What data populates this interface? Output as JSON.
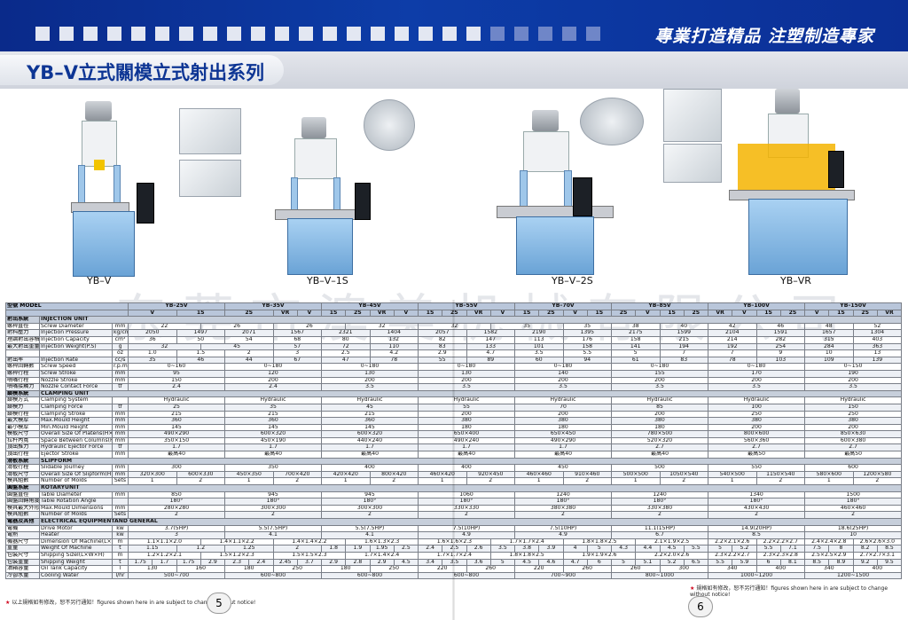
{
  "header": {
    "slogan": "專業打造精品 注塑制造專家",
    "series_title": "YB–V立式關模立式射出系列"
  },
  "colors": {
    "brand_blue": "#0d3da8",
    "section_bg": "#c7cfdb",
    "accent_yellow": "#f4b400"
  },
  "machines": [
    "YB–V",
    "YB–V–1S",
    "YB–V–2S",
    "YB–VR"
  ],
  "watermark": "东莞市澳美机械有限公司",
  "spec": {
    "model_label": "型號 MODEL",
    "models": [
      "YB–25V",
      "YB–35V",
      "YB–45V",
      "YB–55V",
      "YB–70V",
      "YB–85V",
      "YB–100V",
      "YB–150V"
    ],
    "subheads": [
      "V",
      "1S",
      "2S",
      "VR",
      "V",
      "1S",
      "2S",
      "VR",
      "V",
      "1S",
      "2S",
      "VR",
      "V",
      "1S",
      "2S",
      "V",
      "1S",
      "2S",
      "V",
      "1S",
      "2S",
      "VR",
      "V",
      "1S",
      "2S",
      "V",
      "1S",
      "2S",
      "VR"
    ],
    "sections": [
      {
        "zh": "射出系統",
        "en": "INJECTION UNIT",
        "rows": [
          {
            "zh": "螺桿直徑",
            "en": "Screw Diameter",
            "unit": "mm",
            "vals": [
              "22",
              "26",
              "26",
              "32",
              "32",
              "35",
              "35",
              "38",
              "40",
              "42",
              "46",
              "48",
              "52"
            ]
          },
          {
            "zh": "射料壓力",
            "en": "Injection Pressure",
            "unit": "kg/cm²",
            "vals": [
              "2050",
              "1497",
              "2071",
              "1567",
              "2321",
              "1404",
              "2057",
              "1582",
              "2190",
              "1395",
              "2175",
              "1599",
              "2104",
              "1591",
              "1657",
              "1304"
            ]
          },
          {
            "zh": "理論射出容積",
            "en": "Injection Capacity",
            "unit": "cm³",
            "vals": [
              "36",
              "50",
              "54",
              "68",
              "80",
              "132",
              "82",
              "147",
              "113",
              "176",
              "158",
              "215",
              "214",
              "282",
              "315",
              "403"
            ]
          },
          {
            "zh": "最大射出重量",
            "en": "Injection Weight(P.S)",
            "unit": "g",
            "vals": [
              "32",
              "45",
              "57",
              "72",
              "110",
              "83",
              "133",
              "101",
              "158",
              "141",
              "194",
              "192",
              "254",
              "284",
              "363"
            ]
          },
          {
            "zh": "",
            "en": "",
            "unit": "oz",
            "vals": [
              "1.0",
              "1.5",
              "2",
              "3",
              "2.5",
              "4.2",
              "2.9",
              "4.7",
              "3.5",
              "5.5",
              "5",
              "7",
              "7",
              "9",
              "10",
              "13"
            ]
          },
          {
            "zh": "射出率",
            "en": "Injection Rate",
            "unit": "cc/s",
            "vals": [
              "35",
              "46",
              "44",
              "67",
              "47",
              "78",
              "55",
              "89",
              "60",
              "94",
              "61",
              "83",
              "78",
              "103",
              "109",
              "139"
            ]
          },
          {
            "zh": "螺桿回轉數",
            "en": "Screw Speed",
            "unit": "r.p.m",
            "vals": [
              "0~160",
              "0~180",
              "0~180",
              "0~180",
              "0~180",
              "0~180",
              "0~180",
              "0~150"
            ]
          },
          {
            "zh": "螺桿行程",
            "en": "Screw Stroke",
            "unit": "mm",
            "vals": [
              "95",
              "120",
              "130",
              "130",
              "140",
              "155",
              "170",
              "190"
            ]
          },
          {
            "zh": "噴嘴行程",
            "en": "Nozzle Stroke",
            "unit": "mm",
            "vals": [
              "150",
              "200",
              "200",
              "200",
              "200",
              "200",
              "200",
              "200"
            ]
          },
          {
            "zh": "噴嘴接觸力",
            "en": "Nozzle Contact Force",
            "unit": "tf",
            "vals": [
              "2.4",
              "2.4",
              "3.5",
              "3.5",
              "3.5",
              "3.5",
              "3.5",
              "3.5"
            ]
          }
        ]
      },
      {
        "zh": "鎖模系統",
        "en": "CLAMPING UNIT",
        "rows": [
          {
            "zh": "鎖模方式",
            "en": "Clamping System",
            "unit": "",
            "vals": [
              "Hydraulic",
              "Hydraulic",
              "Hydraulic",
              "Hydraulic",
              "Hydraulic",
              "Hydraulic",
              "Hydraulic",
              "Hydraulic"
            ]
          },
          {
            "zh": "鎖模力",
            "en": "Clamping Force",
            "unit": "tf",
            "vals": [
              "25",
              "35",
              "45",
              "55",
              "70",
              "85",
              "100",
              "150"
            ]
          },
          {
            "zh": "鎖模行程",
            "en": "Clamping Stroke",
            "unit": "mm",
            "vals": [
              "215",
              "215",
              "215",
              "200",
              "200",
              "200",
              "250",
              "250"
            ]
          },
          {
            "zh": "最大模厚",
            "en": "Max.Mould Height",
            "unit": "mm",
            "vals": [
              "360",
              "360",
              "360",
              "380",
              "380",
              "380",
              "380",
              "380"
            ]
          },
          {
            "zh": "最小模厚",
            "en": "Min.Mould Height",
            "unit": "mm",
            "vals": [
              "145",
              "145",
              "145",
              "180",
              "180",
              "180",
              "200",
              "200"
            ]
          },
          {
            "zh": "模板尺寸",
            "en": "Overall Size Of Platens(H×V)",
            "unit": "mm",
            "vals": [
              "490×290",
              "600×320",
              "600×320",
              "650×400",
              "650×450",
              "780×500",
              "800×600",
              "850×630"
            ]
          },
          {
            "zh": "拉杆內寬",
            "en": "Space Between Columns(H×V)",
            "unit": "mm",
            "vals": [
              "350×150",
              "450×190",
              "440×240",
              "490×240",
              "490×290",
              "520×320",
              "560×360",
              "600×380"
            ]
          },
          {
            "zh": "頂出推力",
            "en": "Hydraulic Ejector Force",
            "unit": "tf",
            "vals": [
              "1.7",
              "1.7",
              "1.7",
              "1.7",
              "1.7",
              "2.7",
              "2.7",
              "2.7"
            ]
          },
          {
            "zh": "頂出行程",
            "en": "Ejector Stroke",
            "unit": "mm",
            "vals": [
              "最高40",
              "最高40",
              "最高40",
              "最高40",
              "最高40",
              "最高40",
              "最高50",
              "最高50"
            ]
          }
        ]
      },
      {
        "zh": "滑板系統",
        "en": "SLIPFORM",
        "rows": [
          {
            "zh": "滑板行程",
            "en": "Slidable Journey",
            "unit": "mm",
            "vals": [
              "300",
              "350",
              "400",
              "400",
              "450",
              "500",
              "550",
              "600"
            ]
          },
          {
            "zh": "滑板尺寸",
            "en": "Overall Size Of Slipform(H×V)",
            "unit": "mm",
            "vals": [
              "320×300",
              "600×330",
              "450×350",
              "700×420",
              "420×420",
              "800×420",
              "460×420",
              "920×450",
              "460×460",
              "910×460",
              "500×500",
              "1050×540",
              "540×500",
              "1150×540",
              "580×600",
              "1200×580"
            ]
          },
          {
            "zh": "模具組數",
            "en": "Number of Molds",
            "unit": "Sets",
            "vals": [
              "1",
              "2",
              "1",
              "2",
              "1",
              "2",
              "1",
              "2",
              "1",
              "2",
              "1",
              "2",
              "1",
              "2",
              "1",
              "2"
            ]
          }
        ]
      },
      {
        "zh": "圓盤系統",
        "en": "ROTARYUNIT",
        "rows": [
          {
            "zh": "圓盤直徑",
            "en": "Table Diameter",
            "unit": "mm",
            "vals": [
              "850",
              "945",
              "945",
              "1060",
              "1240",
              "1240",
              "1340",
              "1500"
            ]
          },
          {
            "zh": "圓盤回轉角度(左或右轉)",
            "en": "Table Rotation Angle",
            "unit": "",
            "vals": [
              "180°",
              "180°",
              "180°",
              "180°",
              "180°",
              "180°",
              "180°",
              "180°"
            ]
          },
          {
            "zh": "模具最大外形尺寸",
            "en": "Max.Mould Dimensions",
            "unit": "mm",
            "vals": [
              "280×280",
              "300×300",
              "300×300",
              "330×330",
              "380×380",
              "330×380",
              "430×430",
              "460×460"
            ]
          },
          {
            "zh": "模具組數",
            "en": "Number of Molds",
            "unit": "Sets",
            "vals": [
              "2",
              "2",
              "2",
              "2",
              "2",
              "2",
              "2",
              "2"
            ]
          }
        ]
      },
      {
        "zh": "電器及其他",
        "en": "ELECTRICAL EQUIPMENTAND GENERAL",
        "rows": [
          {
            "zh": "電機",
            "en": "Drive Motor",
            "unit": "kw",
            "vals": [
              "3.7(5HP)",
              "5.5(7.5HP)",
              "5.5(7.5HP)",
              "7.5(10HP)",
              "7.5(10HP)",
              "11.1(15HP)",
              "14.9(20HP)",
              "18.6(25HP)"
            ]
          },
          {
            "zh": "電熱",
            "en": "Heater",
            "unit": "kw",
            "vals": [
              "3",
              "4.1",
              "4.1",
              "4.9",
              "4.9",
              "6.7",
              "8.5",
              "10"
            ]
          },
          {
            "zh": "機器尺寸",
            "en": "Dimension Of Machine(L×W×H)",
            "unit": "m",
            "vals": [
              "1.1×1.1×2.0",
              "1.4×1.1×2.2",
              "1.4×1.4×2.2",
              "1.6×1.3×2.3",
              "1.6×1.6×2.3",
              "1.7×1.7×2.4",
              "1.8×1.8×2.5",
              "2.1×1.9×2.5",
              "2.2×2.1×2.6",
              "2.2×2.2×2.7",
              "2.4×2.4×2.8",
              "2.6×2.6×3.0"
            ]
          },
          {
            "zh": "重量",
            "en": "Weight Of Machine",
            "unit": "t",
            "vals": [
              "1.15",
              "1.2",
              "1.25",
              "2",
              "1.8",
              "1.9",
              "1.95",
              "2.5",
              "2.4",
              "2.5",
              "2.6",
              "3.5",
              "3.8",
              "3.9",
              "4",
              "5",
              "4.3",
              "4.4",
              "4.5",
              "5.5",
              "5",
              "5.2",
              "5.5",
              "7.1",
              "7.5",
              "8",
              "8.2",
              "8.5"
            ]
          },
          {
            "zh": "包裝尺寸",
            "en": "Shipping Sizel(L×W×H)",
            "unit": "m",
            "vals": [
              "1.2×1.2×2.1",
              "1.5×1.2×2.3",
              "1.5×1.5×2.3",
              "1.7×1.4×2.4",
              "1.7×1.7×2.4",
              "1.8×1.8×2.5",
              "1.9×1.9×2.6",
              "2.2×2.0×2.6",
              "2.3×2.2×2.7",
              "2.3×2.3×2.8",
              "2.5×2.5×2.9",
              "2.7×2.7×3.1"
            ]
          },
          {
            "zh": "包裝重量",
            "en": "Shipping Weight",
            "unit": "t",
            "vals": [
              "1.75",
              "1.7",
              "1.75",
              "2.9",
              "2.3",
              "2.4",
              "2.45",
              "3.7",
              "2.9",
              "2.8",
              "2.9",
              "4.5",
              "3.4",
              "3.5",
              "3.6",
              "5",
              "4.5",
              "4.6",
              "4.7",
              "6",
              "5",
              "5.1",
              "5.2",
              "6.5",
              "5.5",
              "5.9",
              "6",
              "8.1",
              "8.5",
              "8.9",
              "9.2",
              "9.5"
            ]
          },
          {
            "zh": "油箱容量",
            "en": "Oil Tank Capacity",
            "unit": "l",
            "vals": [
              "130",
              "160",
              "180",
              "250",
              "180",
              "250",
              "220",
              "260",
              "220",
              "260",
              "260",
              "300",
              "340",
              "400",
              "340",
              "400"
            ]
          },
          {
            "zh": "冷卻水量",
            "en": "Cooling Water",
            "unit": "l/hr",
            "vals": [
              "500~700",
              "600~800",
              "600~800",
              "600~800",
              "700~900",
              "800~1000",
              "1000~1200",
              "1200~1500"
            ]
          }
        ]
      }
    ]
  },
  "footer": {
    "left_note": "以上規格如有修改，恕不另行通知！figures shown here in are subject to change without notice!",
    "right_note": "規格如有修改，恕不另行通知！figures shown here in are subject to change without notice!",
    "page_left": "5",
    "page_right": "6"
  }
}
